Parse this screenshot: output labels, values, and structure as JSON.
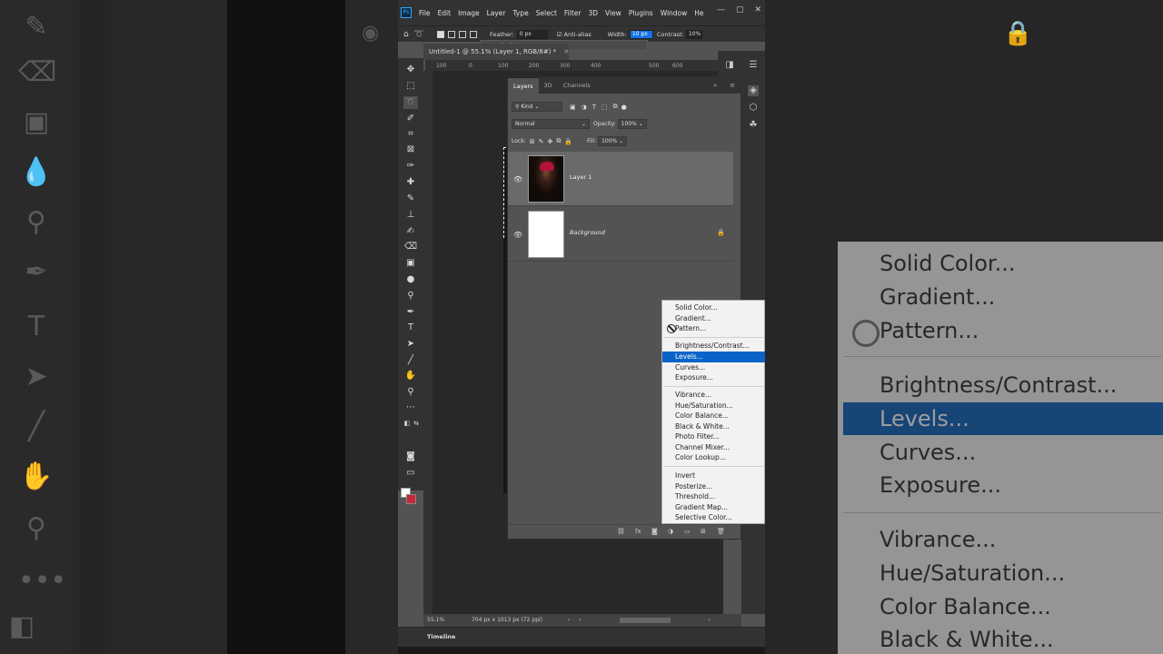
{
  "colors": {
    "accent": "#1473e6",
    "menu_highlight": "#0a64c8",
    "ps_logo": "#31a8ff",
    "bg_swatch": "#c8273a"
  },
  "menubar": {
    "logo": "Ps",
    "items": [
      "File",
      "Edit",
      "Image",
      "Layer",
      "Type",
      "Select",
      "Filter",
      "3D",
      "View",
      "Plugins",
      "Window",
      "He"
    ]
  },
  "options": {
    "feather_label": "Feather:",
    "feather_value": "0 px",
    "antialias_label": "Anti-alias",
    "width_label": "Width:",
    "width_value": "10 px",
    "contrast_label": "Contrast:",
    "contrast_value": "10%"
  },
  "language_bar": {
    "label": "English"
  },
  "document": {
    "tab_title": "Untitled-1 @ 55.1% (Layer 1, RGB/8#) *"
  },
  "ruler_top": [
    "100",
    "0",
    "100",
    "200",
    "300",
    "400",
    "500",
    "600"
  ],
  "layers_panel": {
    "tabs": [
      "Layers",
      "3D",
      "Channels"
    ],
    "filter_label": "Kind",
    "blend_mode": "Normal",
    "opacity_label": "Opacity:",
    "opacity_value": "100%",
    "lock_label": "Lock:",
    "fill_label": "Fill:",
    "fill_value": "100%",
    "layers": [
      {
        "name": "Layer 1",
        "selected": true
      },
      {
        "name": "Background",
        "locked": true
      }
    ]
  },
  "adjustment_menu": {
    "groups": [
      [
        "Solid Color...",
        "Gradient...",
        "Pattern..."
      ],
      [
        "Brightness/Contrast...",
        "Levels...",
        "Curves...",
        "Exposure..."
      ],
      [
        "Vibrance...",
        "Hue/Saturation...",
        "Color Balance...",
        "Black & White...",
        "Photo Filter...",
        "Channel Mixer...",
        "Color Lookup..."
      ],
      [
        "Invert",
        "Posterize...",
        "Threshold...",
        "Gradient Map...",
        "Selective Color..."
      ]
    ],
    "highlighted": "Levels..."
  },
  "status": {
    "zoom": "55.1%",
    "doc_size": "704 px x 1013 px (72 ppi)"
  },
  "timeline_label": "Timeline",
  "bg_zoom_menu": [
    "Solid Color...",
    "Gradient...",
    "Pattern...",
    "Brightness/Contrast...",
    "Levels...",
    "Curves...",
    "Exposure...",
    "Vibrance...",
    "Hue/Saturation...",
    "Color Balance...",
    "Black & White..."
  ]
}
